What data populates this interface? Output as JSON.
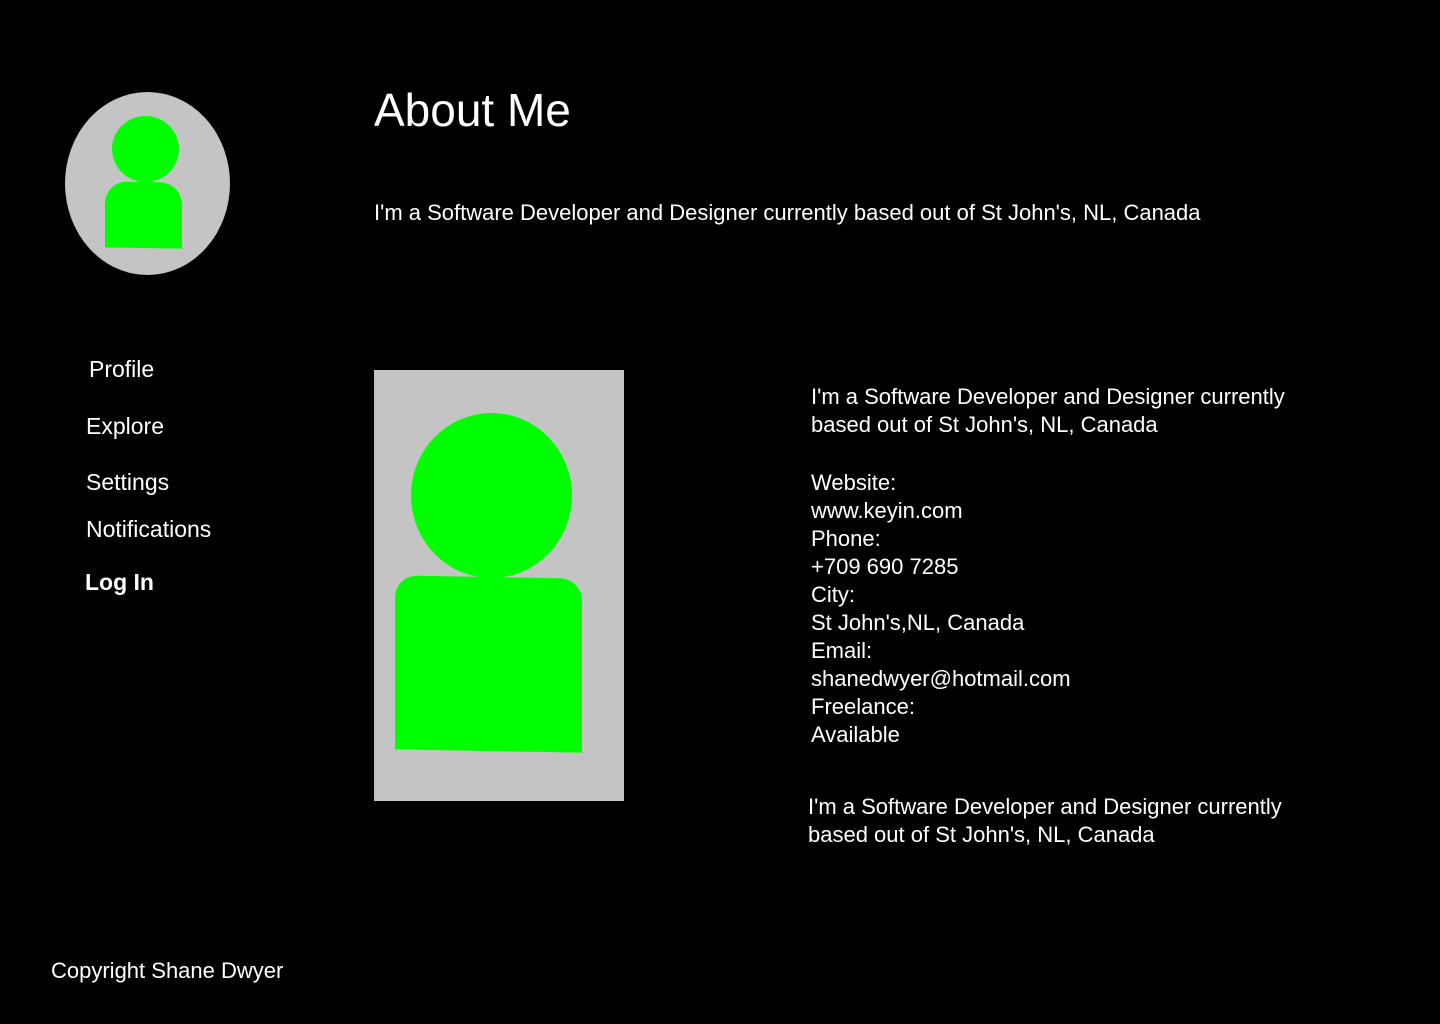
{
  "header": {
    "title": "About Me",
    "intro": "I'm a Software Developer and Designer currently based out of St John's, NL, Canada"
  },
  "sidebar": {
    "items": [
      {
        "label": "Profile"
      },
      {
        "label": "Explore"
      },
      {
        "label": "Settings"
      },
      {
        "label": "Notifications"
      },
      {
        "label": "Log In"
      }
    ]
  },
  "details": {
    "summary_line1": "I'm a Software Developer and Designer currently",
    "summary_line2": "based out of St John's, NL, Canada",
    "website_label": "Website:",
    "website_value": "www.keyin.com",
    "phone_label": "Phone:",
    "phone_value": "+709 690 7285",
    "city_label": "City:",
    "city_value": "St John's,NL, Canada",
    "email_label": "Email:",
    "email_value": "shanedwyer@hotmail.com",
    "freelance_label": "Freelance:",
    "freelance_value": "Available"
  },
  "outro": {
    "line1": "I'm a Software Developer and Designer currently",
    "line2": "based out of St John's, NL, Canada"
  },
  "footer": {
    "copyright": "Copyright Shane Dwyer"
  },
  "colors": {
    "background": "#000000",
    "text": "#ffffff",
    "placeholder_bg": "#c4c4c4",
    "avatar_figure": "#00ff00"
  }
}
